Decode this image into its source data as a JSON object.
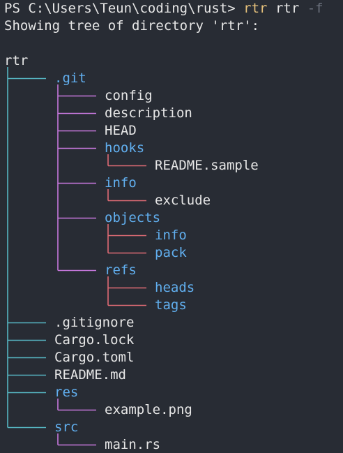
{
  "prompt": {
    "ps_prefix": "PS C:\\Users\\Teun\\coding\\rust> ",
    "command": "rtr",
    "argument": " rtr ",
    "flag": "-f"
  },
  "output": {
    "heading": "Showing tree of directory 'rtr':",
    "root_name": "rtr"
  },
  "colors": {
    "background": "#282c34",
    "text": "#e6e6e6",
    "directory": "#61afef",
    "command": "#e5c07b",
    "flag": "#6b717d",
    "level1_connector": "#56b6c2",
    "level2_connector": "#c678dd",
    "level3_connector": "#e06c75"
  },
  "tree": [
    {
      "name": ".git",
      "type": "dir",
      "depth": 1
    },
    {
      "name": "config",
      "type": "file",
      "depth": 2
    },
    {
      "name": "description",
      "type": "file",
      "depth": 2
    },
    {
      "name": "HEAD",
      "type": "file",
      "depth": 2
    },
    {
      "name": "hooks",
      "type": "dir",
      "depth": 2
    },
    {
      "name": "README.sample",
      "type": "file",
      "depth": 3
    },
    {
      "name": "info",
      "type": "dir",
      "depth": 2
    },
    {
      "name": "exclude",
      "type": "file",
      "depth": 3
    },
    {
      "name": "objects",
      "type": "dir",
      "depth": 2
    },
    {
      "name": "info",
      "type": "dir",
      "depth": 3
    },
    {
      "name": "pack",
      "type": "dir",
      "depth": 3
    },
    {
      "name": "refs",
      "type": "dir",
      "depth": 2
    },
    {
      "name": "heads",
      "type": "dir",
      "depth": 3
    },
    {
      "name": "tags",
      "type": "dir",
      "depth": 3
    },
    {
      "name": ".gitignore",
      "type": "file",
      "depth": 1
    },
    {
      "name": "Cargo.lock",
      "type": "file",
      "depth": 1
    },
    {
      "name": "Cargo.toml",
      "type": "file",
      "depth": 1
    },
    {
      "name": "README.md",
      "type": "file",
      "depth": 1
    },
    {
      "name": "res",
      "type": "dir",
      "depth": 1
    },
    {
      "name": "example.png",
      "type": "file",
      "depth": 2
    },
    {
      "name": "src",
      "type": "dir",
      "depth": 1
    },
    {
      "name": "main.rs",
      "type": "file",
      "depth": 2
    }
  ]
}
